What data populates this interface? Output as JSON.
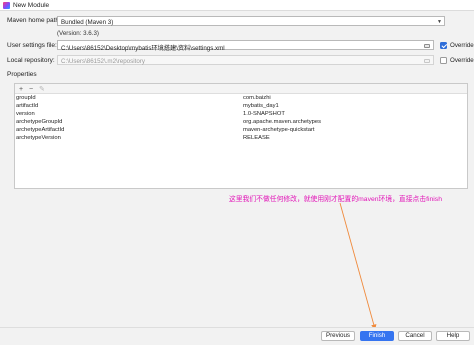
{
  "window": {
    "title": "New Module"
  },
  "maven_home": {
    "label": "Maven home path:",
    "value": "Bundled (Maven 3)",
    "version_note": "(Version: 3.6.3)"
  },
  "user_settings": {
    "label": "User settings file:",
    "value": "C:\\Users\\86152\\Desktop\\mybatis环境搭建\\资料\\settings.xml",
    "override_label": "Override",
    "override_checked": true
  },
  "local_repo": {
    "label": "Local repository:",
    "value": "C:\\Users\\86152\\.m2\\repository",
    "override_label": "Override",
    "override_checked": false
  },
  "properties": {
    "header": "Properties",
    "toolbar": {
      "add": "+",
      "remove": "−",
      "edit": "✎"
    },
    "rows": [
      {
        "key": "groupId",
        "value": "com.baizhi"
      },
      {
        "key": "artifactId",
        "value": "mybatis_day1"
      },
      {
        "key": "version",
        "value": "1.0-SNAPSHOT"
      },
      {
        "key": "archetypeGroupId",
        "value": "org.apache.maven.archetypes"
      },
      {
        "key": "archetypeArtifactId",
        "value": "maven-archetype-quickstart"
      },
      {
        "key": "archetypeVersion",
        "value": "RELEASE"
      }
    ]
  },
  "annotation": {
    "text": "这里我们不做任何修改，就使用刚才配置的maven环境，直接点击finish",
    "color": "#e216b8"
  },
  "buttons": {
    "previous": "Previous",
    "finish": "Finish",
    "cancel": "Cancel",
    "help": "Help"
  },
  "colors": {
    "accent": "#3574f0",
    "annotation_arrow": "#f08a3c"
  }
}
